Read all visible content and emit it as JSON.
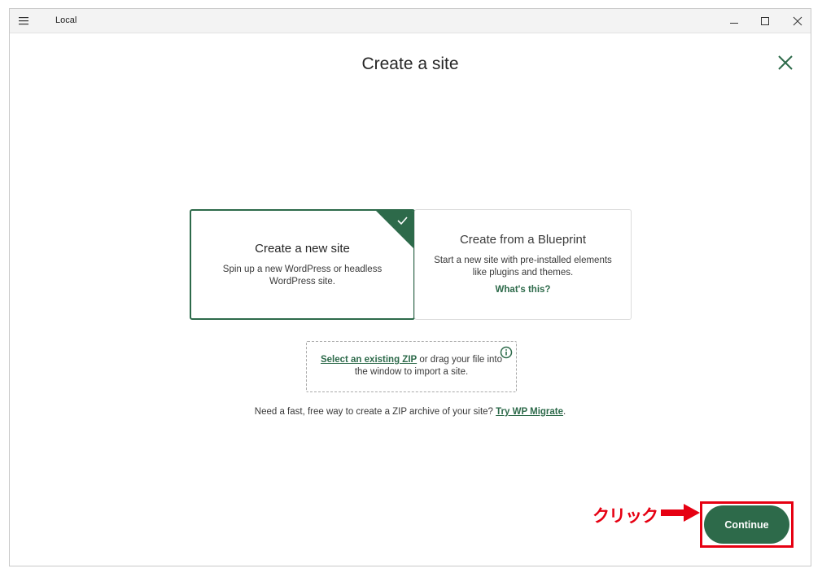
{
  "window": {
    "app_title": "Local"
  },
  "page": {
    "heading": "Create a site"
  },
  "options": [
    {
      "title": "Create a new site",
      "description": "Spin up a new WordPress or headless WordPress site.",
      "selected": true
    },
    {
      "title": "Create from a Blueprint",
      "description": "Start a new site with pre-installed elements like plugins and themes.",
      "link": "What's this?",
      "selected": false
    }
  ],
  "import_zip": {
    "link": "Select an existing ZIP",
    "text": " or drag your file into the window to import a site."
  },
  "migrate": {
    "text": "Need a fast, free way to create a ZIP archive of your site? ",
    "link": "Try WP Migrate",
    "suffix": "."
  },
  "annotation": {
    "label": "クリック"
  },
  "footer": {
    "continue_label": "Continue"
  },
  "colors": {
    "accent": "#2d6a4a",
    "annotation": "#e60012"
  },
  "icons": {
    "menu": "hamburger-menu-icon",
    "minimize": "minimize-icon",
    "maximize": "maximize-icon",
    "close_window": "close-window-icon",
    "close_dialog": "close-icon",
    "selected_check": "checkmark-icon",
    "info": "info-icon",
    "annotation_arrow": "arrow-right-icon"
  }
}
